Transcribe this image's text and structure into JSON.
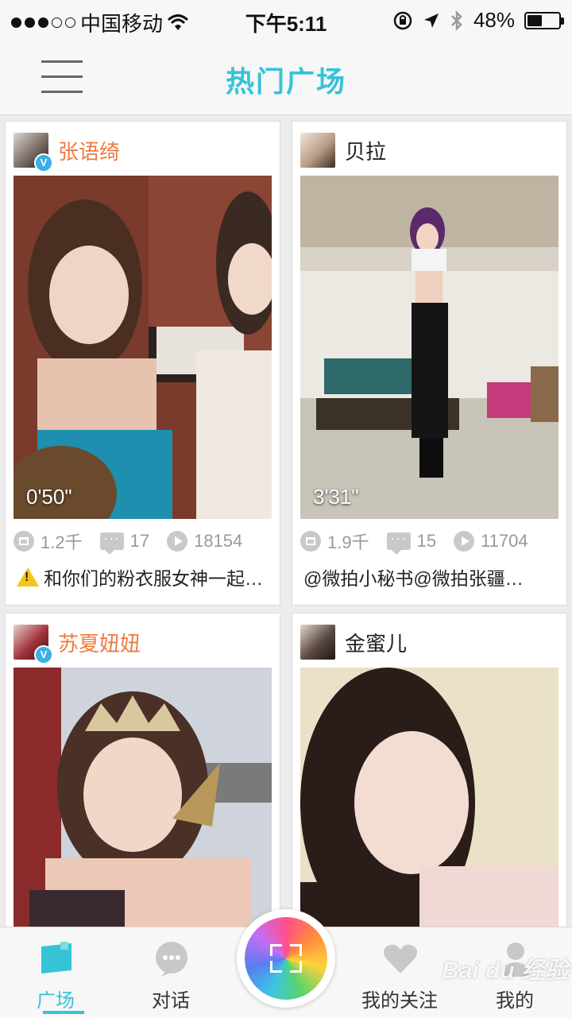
{
  "status_bar": {
    "carrier": "中国移动",
    "time": "下午5:11",
    "battery_percent": "48%",
    "battery_level": 0.48
  },
  "nav": {
    "title": "热门广场",
    "menu_icon": "hamburger-menu-icon"
  },
  "feed": [
    {
      "user": "张语绮",
      "verified": true,
      "duration": "0'50\"",
      "gifts": "1.2千",
      "comments": "17",
      "plays": "18154",
      "caption": "和你们的粉衣服女神一起…",
      "caption_icon": "warning-icon"
    },
    {
      "user": "贝拉",
      "verified": false,
      "duration": "3'31\"",
      "gifts": "1.9千",
      "comments": "15",
      "plays": "11704",
      "caption": "@微拍小秘书@微拍张疆…"
    },
    {
      "user": "苏夏妞妞",
      "verified": true
    },
    {
      "user": "金蜜儿",
      "verified": false
    }
  ],
  "tabs": [
    {
      "label": "广场",
      "icon": "square-icon",
      "active": true
    },
    {
      "label": "对话",
      "icon": "chat-bubble-icon",
      "active": false
    },
    {
      "label": "我的关注",
      "icon": "heart-icon",
      "active": false
    },
    {
      "label": "我的",
      "icon": "person-icon",
      "active": false
    }
  ],
  "watermark": "Bai du 经验",
  "colors": {
    "accent": "#35c3d6",
    "vip_name": "#ef7a41",
    "verified_badge": "#3ab0e4"
  }
}
